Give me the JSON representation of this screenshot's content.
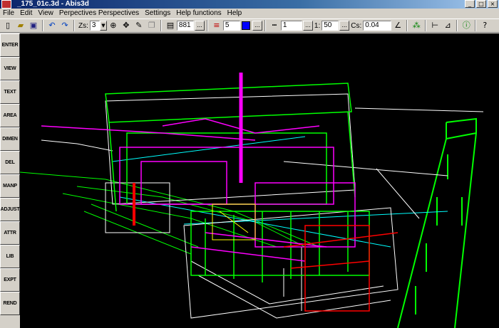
{
  "window": {
    "title": "_175_01c.3d - Abis3d",
    "controls": {
      "minimize": "_",
      "maximize": "□",
      "close": "×"
    }
  },
  "menu": [
    "File",
    "Edit",
    "View",
    "Perpectives Perspectives",
    "Settings",
    "Help functions",
    "Help"
  ],
  "toolbar": {
    "zs_label": "Zs:",
    "zs_value": "3",
    "layer_value": "881",
    "pen_value": "5",
    "swatch_color": "#0000ff",
    "line_value": "1",
    "scale_label": "1:",
    "scale_value": "50",
    "cs_label": "Cs:",
    "cs_value": "0.04",
    "dots": "..."
  },
  "commands": [
    "ENTER",
    "VIEW",
    "TEXT",
    "AREA",
    "DIMEN",
    "DEL",
    "MANP",
    "ADJUST",
    "ATTR",
    "LIB",
    "EXPT",
    "REND"
  ],
  "viewport": {
    "background": "#000000",
    "wire_colors": [
      "#00ff00",
      "#ffffff",
      "#ff00ff",
      "#00ffff",
      "#ff0000",
      "#ffff00"
    ]
  }
}
